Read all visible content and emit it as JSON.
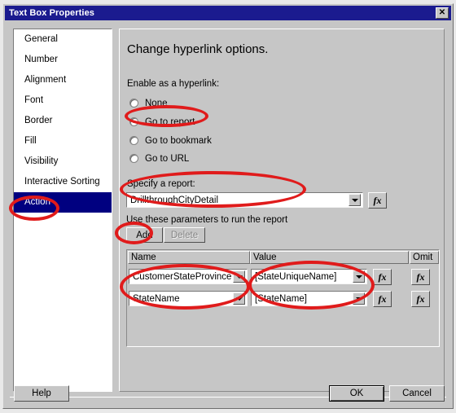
{
  "window": {
    "title": "Text Box Properties",
    "close_label": "✕",
    "close_icon": "close-icon"
  },
  "sidebar": {
    "items": [
      {
        "label": "General",
        "selected": false
      },
      {
        "label": "Number",
        "selected": false
      },
      {
        "label": "Alignment",
        "selected": false
      },
      {
        "label": "Font",
        "selected": false
      },
      {
        "label": "Border",
        "selected": false
      },
      {
        "label": "Fill",
        "selected": false
      },
      {
        "label": "Visibility",
        "selected": false
      },
      {
        "label": "Interactive Sorting",
        "selected": false
      },
      {
        "label": "Action",
        "selected": true
      }
    ]
  },
  "main": {
    "heading": "Change hyperlink options.",
    "enable_label": "Enable as a hyperlink:",
    "radios": [
      {
        "label": "None",
        "selected": false
      },
      {
        "label": "Go to report",
        "selected": true
      },
      {
        "label": "Go to bookmark",
        "selected": false
      },
      {
        "label": "Go to URL",
        "selected": false
      }
    ],
    "specify_label": "Specify a report:",
    "report": {
      "value": "DrillthroughCityDetail",
      "fx_label": "fx"
    },
    "params_label": "Use these parameters to run the report",
    "add_label": "Add",
    "delete_label": "Delete",
    "grid": {
      "columns": [
        "Name",
        "Value",
        "Omit"
      ],
      "rows": [
        {
          "name": "CustomerStateProvince",
          "value": "[StateUniqueName]",
          "value_fx": "fx",
          "omit_fx": "fx"
        },
        {
          "name": "StateName",
          "value": "[StateName]",
          "value_fx": "fx",
          "omit_fx": "fx"
        }
      ]
    }
  },
  "footer": {
    "help_label": "Help",
    "ok_label": "OK",
    "cancel_label": "Cancel"
  },
  "annotations": {
    "color": "#e01b1b",
    "targets": [
      "sidebar-item-action",
      "radio-go-to-report",
      "specify-a-report",
      "add-button",
      "parameter-name-column",
      "parameter-value-column"
    ]
  }
}
